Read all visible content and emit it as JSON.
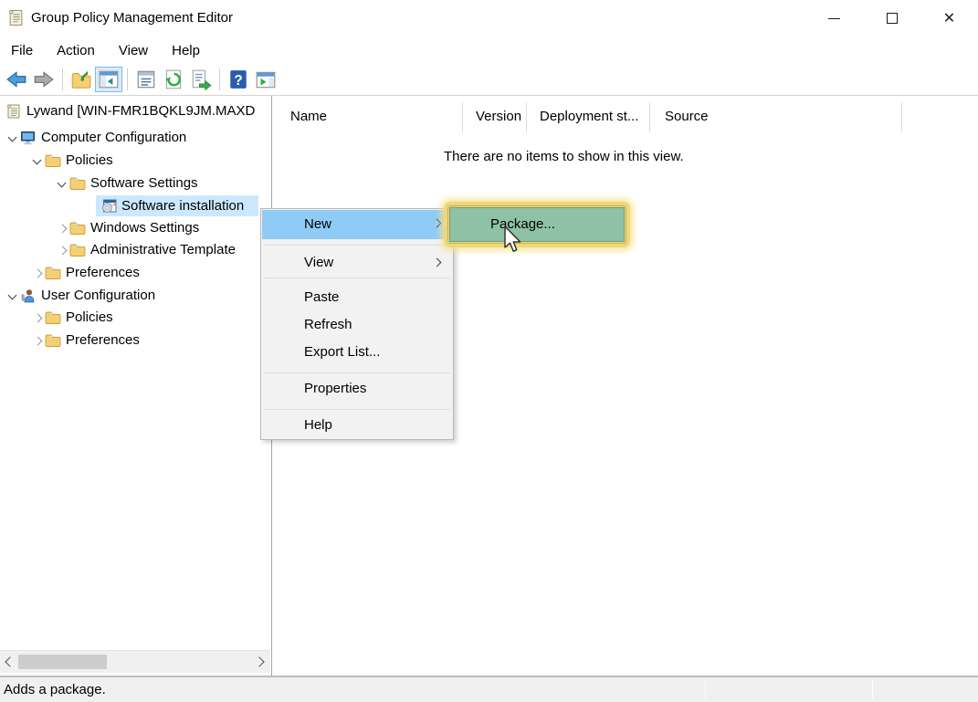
{
  "window": {
    "title": "Group Policy Management Editor"
  },
  "menubar": {
    "items": [
      {
        "label": "File"
      },
      {
        "label": "Action"
      },
      {
        "label": "View"
      },
      {
        "label": "Help"
      }
    ]
  },
  "toolbar": {
    "buttons": [
      "back",
      "forward",
      "up-one-level",
      "show-hide-console-tree",
      "properties",
      "refresh",
      "export-list",
      "help",
      "new-window"
    ]
  },
  "tree": {
    "items": [
      {
        "label": "Lywand [WIN-FMR1BQKL9JM.MAXD",
        "level": 0,
        "icon": "gpo-scroll",
        "expander": "none",
        "selected": false
      },
      {
        "label": "Computer Configuration",
        "level": 1,
        "icon": "computer",
        "expander": "expanded",
        "selected": false
      },
      {
        "label": "Policies",
        "level": 2,
        "icon": "folder",
        "expander": "expanded",
        "selected": false
      },
      {
        "label": "Software Settings",
        "level": 3,
        "icon": "folder",
        "expander": "expanded",
        "selected": false
      },
      {
        "label": "Software installation",
        "level": 4,
        "icon": "software-installation",
        "expander": "none",
        "selected": true
      },
      {
        "label": "Windows Settings",
        "level": 3,
        "icon": "folder",
        "expander": "collapsed",
        "selected": false
      },
      {
        "label": "Administrative Template",
        "level": 3,
        "icon": "folder",
        "expander": "collapsed",
        "selected": false
      },
      {
        "label": "Preferences",
        "level": 2,
        "icon": "folder",
        "expander": "collapsed",
        "selected": false
      },
      {
        "label": "User Configuration",
        "level": 1,
        "icon": "user",
        "expander": "expanded",
        "selected": false
      },
      {
        "label": "Policies",
        "level": 2,
        "icon": "folder",
        "expander": "collapsed",
        "selected": false
      },
      {
        "label": "Preferences",
        "level": 2,
        "icon": "folder",
        "expander": "collapsed",
        "selected": false
      }
    ]
  },
  "list": {
    "columns": [
      {
        "label": "Name"
      },
      {
        "label": "Version"
      },
      {
        "label": "Deployment st..."
      },
      {
        "label": "Source"
      }
    ],
    "empty_text": "There are no items to show in this view."
  },
  "context_menu": {
    "items": [
      {
        "label": "New",
        "submenu": true,
        "highlighted": true
      },
      {
        "label": "View",
        "submenu": true,
        "highlighted": false
      },
      {
        "label": "Paste",
        "submenu": false,
        "highlighted": false
      },
      {
        "label": "Refresh",
        "submenu": false,
        "highlighted": false
      },
      {
        "label": "Export List...",
        "submenu": false,
        "highlighted": false
      },
      {
        "label": "Properties",
        "submenu": false,
        "highlighted": false
      },
      {
        "label": "Help",
        "submenu": false,
        "highlighted": false
      }
    ]
  },
  "submenu": {
    "items": [
      {
        "label": "Package...",
        "highlighted": true
      }
    ]
  },
  "statusbar": {
    "text": "Adds a package."
  },
  "colors": {
    "menu_highlight": "#8fcbf5",
    "tree_selection": "#cce8ff",
    "annotation_fill": "#8fc2a5",
    "annotation_glow": "#edd87c",
    "statusbar_bg": "#f0f0f0"
  }
}
